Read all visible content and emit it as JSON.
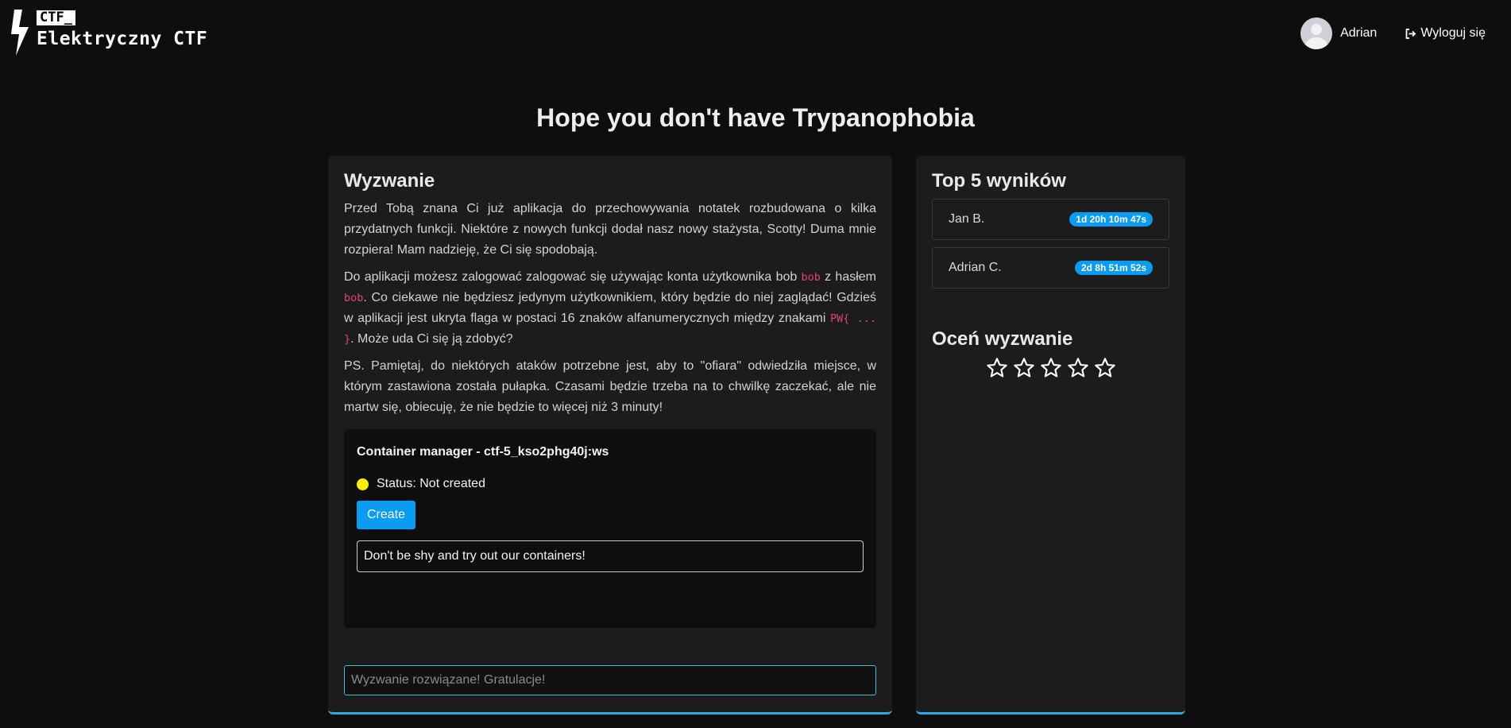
{
  "header": {
    "logo_tag": "CTF_",
    "logo_name": "Elektryczny CTF",
    "user_name": "Adrian",
    "logout_label": "Wyloguj się"
  },
  "page": {
    "title": "Hope you don't have Trypanophobia"
  },
  "challenge": {
    "heading": "Wyzwanie",
    "p1": "Przed Tobą znana Ci już aplikacja do przechowywania notatek rozbudowana o kilka przydatnych funkcji. Niektóre z nowych funkcji dodał nasz nowy stażysta, Scotty! Duma mnie rozpiera! Mam nadzieję, że Ci się spodobają.",
    "p2_a": "Do aplikacji możesz zalogować zalogować się używając konta użytkownika bob ",
    "p2_code1": "bob",
    "p2_b": " z hasłem ",
    "p2_code2": "bob",
    "p2_c": ". Co ciekawe nie będziesz jedynym użytkownikiem, który będzie do niej zaglądać! Gdzieś w aplikacji jest ukryta flaga w postaci 16 znaków alfanumerycznych między znakami ",
    "p2_code3": "PW{ ... }",
    "p2_d": ". Może uda Ci się ją zdobyć?",
    "p3": "PS. Pamiętaj, do niektórych ataków potrzebne jest, aby to \"ofiara\" odwiedziła miejsce, w którym zastawiona została pułapka. Czasami będzie trzeba na to chwilkę zaczekać, ale nie martw się, obiecuję, że nie będzie to więcej niż 3 minuty!"
  },
  "container": {
    "title": "Container manager - ctf-5_kso2phg40j:ws",
    "status": "Status: Not created",
    "status_color": "#ffee00",
    "create_label": "Create",
    "message": "Don't be shy and try out our containers!"
  },
  "flag_input": {
    "placeholder": "Wyzwanie rozwiązane! Gratulacje!"
  },
  "scores": {
    "heading": "Top 5 wyników",
    "items": [
      {
        "name": "Jan B.",
        "time": "1d 20h 10m 47s"
      },
      {
        "name": "Adrian C.",
        "time": "2d 8h 51m 52s"
      }
    ]
  },
  "rating": {
    "heading": "Oceń wyzwanie",
    "stars": 5,
    "selected": 0
  },
  "colors": {
    "accent": "#0a9cf2",
    "background": "#0e0e0f",
    "panel": "#1c1c1d",
    "code": "#e0427c"
  }
}
